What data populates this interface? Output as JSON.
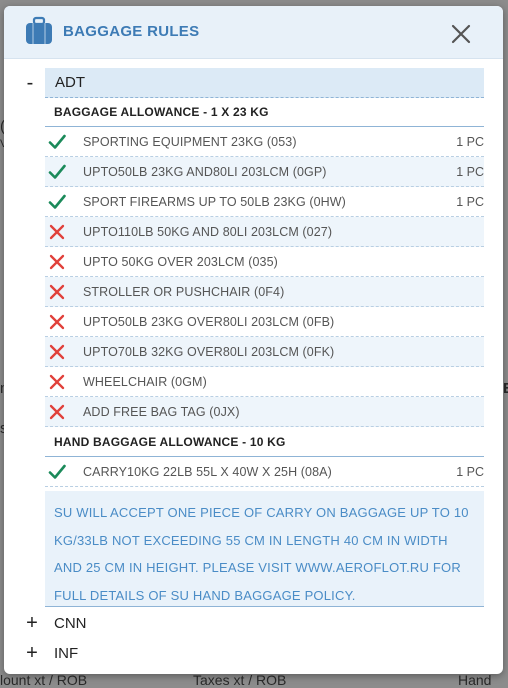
{
  "background": {
    "fragments": [
      "(",
      "V",
      "n",
      "s",
      "E",
      "lount xt / ROB",
      "Taxes xt / ROB",
      "Hand"
    ]
  },
  "modal": {
    "title": "BAGGAGE RULES",
    "header_icon": "suitcase-icon",
    "close_icon": "close-icon",
    "colors": {
      "accent": "#3d7bb5",
      "check": "#1b8a5a",
      "cross": "#e0403a",
      "note_text": "#4a8cc6"
    }
  },
  "passengers": [
    {
      "toggle": "-",
      "label": "ADT",
      "expanded": true,
      "baggage_allowance": {
        "heading": "BAGGAGE ALLOWANCE - 1 X 23 KG",
        "items": [
          {
            "allowed": true,
            "text": "SPORTING EQUIPMENT 23KG (053)",
            "qty": "1 PC"
          },
          {
            "allowed": true,
            "text": "UPTO50LB 23KG AND80LI 203LCM (0GP)",
            "qty": "1 PC"
          },
          {
            "allowed": true,
            "text": "SPORT FIREARMS UP TO 50LB 23KG (0HW)",
            "qty": "1 PC"
          },
          {
            "allowed": false,
            "text": "UPTO110LB 50KG AND 80LI 203LCM (027)",
            "qty": ""
          },
          {
            "allowed": false,
            "text": "UPTO 50KG OVER 203LCM (035)",
            "qty": ""
          },
          {
            "allowed": false,
            "text": "STROLLER OR PUSHCHAIR (0F4)",
            "qty": ""
          },
          {
            "allowed": false,
            "text": "UPTO50LB 23KG OVER80LI 203LCM (0FB)",
            "qty": ""
          },
          {
            "allowed": false,
            "text": "UPTO70LB 32KG OVER80LI 203LCM (0FK)",
            "qty": ""
          },
          {
            "allowed": false,
            "text": "WHEELCHAIR (0GM)",
            "qty": ""
          },
          {
            "allowed": false,
            "text": "ADD FREE BAG TAG (0JX)",
            "qty": ""
          }
        ]
      },
      "hand_baggage": {
        "heading": "HAND BAGGAGE ALLOWANCE - 10 KG",
        "items": [
          {
            "allowed": true,
            "text": "CARRY10KG 22LB 55L X 40W X 25H (08A)",
            "qty": "1 PC"
          }
        ],
        "note_lines": [
          "SU WILL ACCEPT ONE PIECE OF CARRY ON BAGGAGE UP TO 10",
          "KG/33LB NOT EXCEEDING 55 CM IN LENGTH 40 CM IN WIDTH",
          "AND 25 CM IN HEIGHT. PLEASE VISIT WWW.AEROFLOT.RU FOR",
          "FULL DETAILS OF SU HAND BAGGAGE POLICY."
        ]
      }
    },
    {
      "toggle": "+",
      "label": "CNN",
      "expanded": false
    },
    {
      "toggle": "+",
      "label": "INF",
      "expanded": false
    }
  ]
}
